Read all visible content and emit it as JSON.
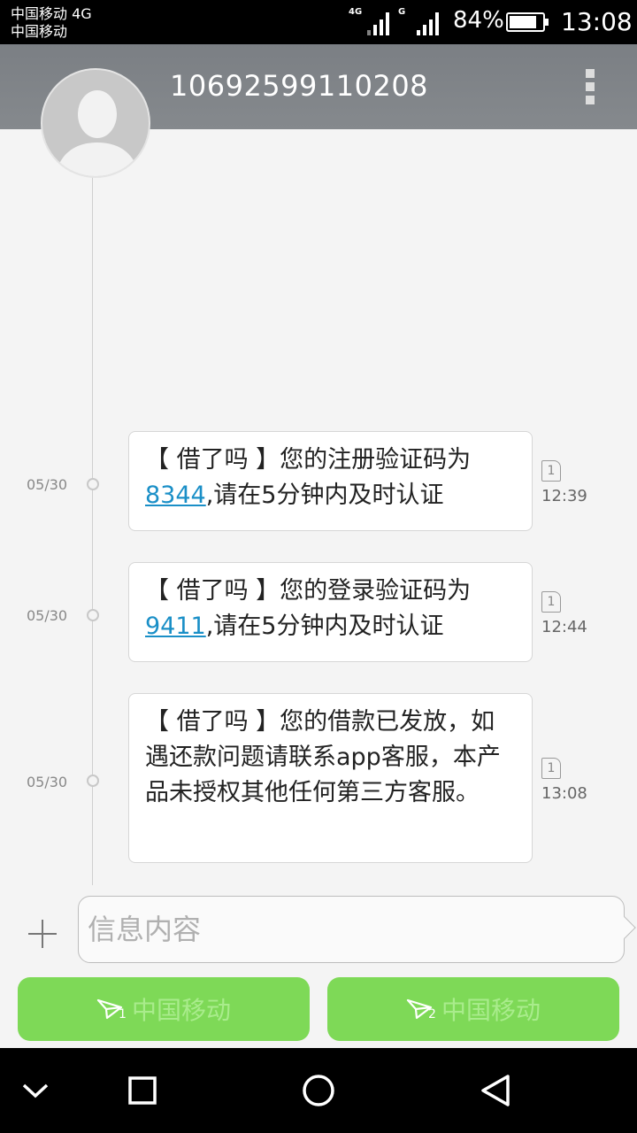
{
  "status_bar": {
    "carrier_line1": "中国移动 4G",
    "carrier_line2": "中国移动",
    "sim1_network": "4G",
    "sim2_network": "G",
    "battery": "84%",
    "time": "13:08"
  },
  "header": {
    "title": "10692599110208",
    "more_icon": "more-vert-icon"
  },
  "messages": [
    {
      "date": "05/30",
      "prefix": "【 借了吗 】您的注册验证码为",
      "code": "8344",
      "suffix": ",请在5分钟内及时认证",
      "sim": "1",
      "time": "12:39"
    },
    {
      "date": "05/30",
      "prefix": "【 借了吗 】您的登录验证码为",
      "code": "9411",
      "suffix": ",请在5分钟内及时认证",
      "sim": "1",
      "time": "12:44"
    },
    {
      "date": "05/30",
      "text": "【 借了吗 】您的借款已发放，如遇还款问题请联系app客服，本产品未授权其他任何第三方客服。",
      "sim": "1",
      "time": "13:08"
    }
  ],
  "compose": {
    "placeholder": "信息内容",
    "value": ""
  },
  "send_buttons": [
    {
      "sim": "1",
      "label": "中国移动"
    },
    {
      "sim": "2",
      "label": "中国移动"
    }
  ],
  "colors": {
    "header": "#808488",
    "send_button": "#7ed957",
    "link": "#1a8fc7"
  }
}
